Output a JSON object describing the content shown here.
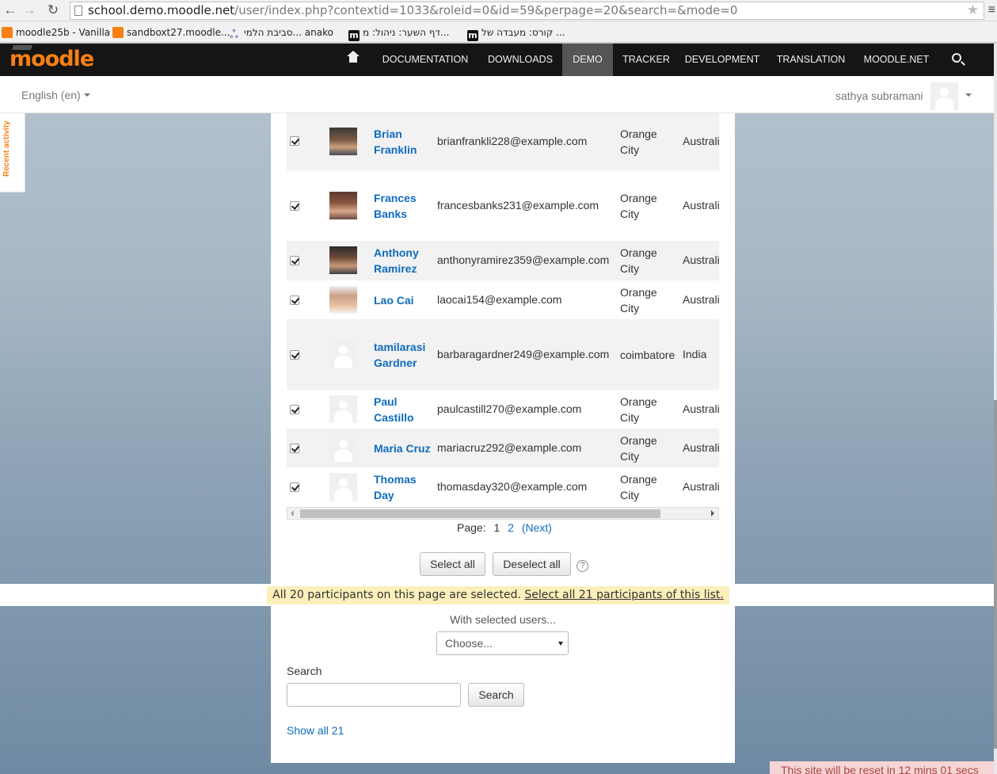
{
  "browser": {
    "url_host": "school.demo.moodle.net",
    "url_path": "/user/index.php?contextid=1033&roleid=0&id=59&perpage=20&search=&mode=0",
    "bookmarks": [
      {
        "label": "moodle25b - Vanilla",
        "icon": "moodle-favicon"
      },
      {
        "label": "sandboxt27.moodle...",
        "icon": "moodle-favicon"
      },
      {
        "label": "סביבת הלמי... anako",
        "icon": "anako-favicon"
      },
      {
        "label": "דף השער: ניהול: מ...",
        "icon": "moodle-m-favicon"
      },
      {
        "label": "קורס: מעבדה של ...",
        "icon": "moodle-m-favicon"
      }
    ]
  },
  "navbar": {
    "logo": "moodle",
    "items": [
      "DOCUMENTATION",
      "DOWNLOADS",
      "DEMO",
      "TRACKER",
      "DEVELOPMENT",
      "TRANSLATION",
      "MOODLE.NET"
    ],
    "active": "DEMO",
    "accent": "#f98012"
  },
  "header": {
    "language": "English (en)",
    "user_name": "sathya subramani"
  },
  "recent_activity_label": "Recent activity",
  "participants": [
    {
      "first": "Brian",
      "last": "Franklin",
      "email": "brianfrankli228@example.com",
      "city1": "Orange",
      "city2": "City",
      "country": "Australi",
      "photo": "photo-1"
    },
    {
      "first": "Frances",
      "last": "Banks",
      "email": "francesbanks231@example.com",
      "city1": "Orange",
      "city2": "City",
      "country": "Australi",
      "photo": "photo-2"
    },
    {
      "first": "Anthony",
      "last": "Ramirez",
      "email": "anthonyramirez359@example.com",
      "city1": "Orange",
      "city2": "City",
      "country": "Australi",
      "photo": "photo-3"
    },
    {
      "first": "Lao Cai",
      "last": "",
      "email": "laocai154@example.com",
      "city1": "Orange",
      "city2": "City",
      "country": "Australi",
      "photo": "photo-4"
    },
    {
      "first": "tamilarasi",
      "last": "Gardner",
      "email": "barbaragardner249@example.com",
      "city1": "coimbatore",
      "city2": "",
      "country": "India",
      "photo": "default"
    },
    {
      "first": "Paul",
      "last": "Castillo",
      "email": "paulcastill270@example.com",
      "city1": "Orange",
      "city2": "City",
      "country": "Australi",
      "photo": "default"
    },
    {
      "first": "Maria Cruz",
      "last": "",
      "email": "mariacruz292@example.com",
      "city1": "Orange",
      "city2": "City",
      "country": "Australi",
      "photo": "default"
    },
    {
      "first": "Thomas",
      "last": "Day",
      "email": "thomasday320@example.com",
      "city1": "Orange",
      "city2": "City",
      "country": "Australi",
      "photo": "default"
    }
  ],
  "paging": {
    "label": "Page:",
    "pages": [
      "1",
      "2"
    ],
    "next": "(Next)"
  },
  "buttons": {
    "select_all": "Select all",
    "deselect_all": "Deselect all",
    "search": "Search"
  },
  "notice": {
    "text": "All 20 participants on this page are selected.",
    "link": "Select all 21 participants of this list."
  },
  "with_selected": {
    "label": "With selected users...",
    "choose": "Choose..."
  },
  "search": {
    "label": "Search",
    "value": ""
  },
  "show_all": "Show all 21",
  "reset_notice": "This site will be reset in 12 mins 01 secs"
}
